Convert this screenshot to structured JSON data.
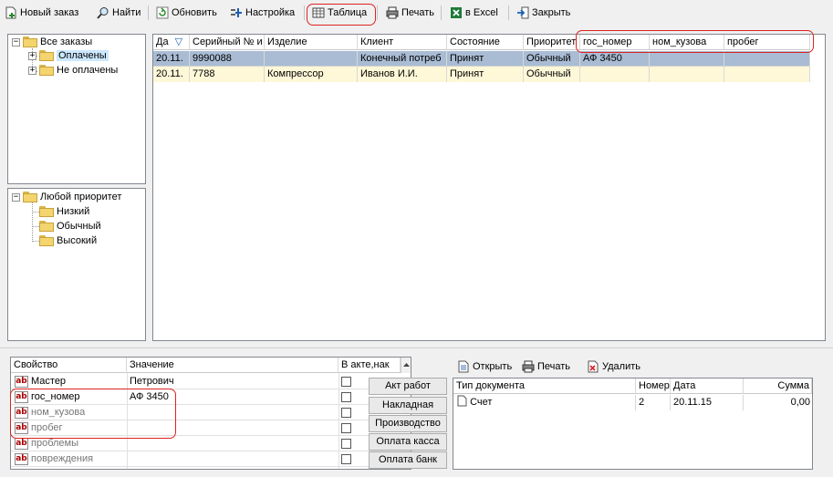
{
  "toolbar": {
    "new_order": "Новый заказ",
    "find": "Найти",
    "refresh": "Обновить",
    "settings": "Настройка",
    "table": "Таблица",
    "print": "Печать",
    "excel": "в Excel",
    "close": "Закрыть"
  },
  "tree_orders": {
    "root": "Все заказы",
    "paid": "Оплачены",
    "unpaid": "Не оплачены"
  },
  "tree_priority": {
    "root": "Любой приоритет",
    "low": "Низкий",
    "normal": "Обычный",
    "high": "Высокий"
  },
  "orders_grid": {
    "headers": [
      "Да",
      "Серийный № и",
      "Изделие",
      "Клиент",
      "Состояние",
      "Приоритет",
      "гос_номер",
      "ном_кузова",
      "пробег"
    ],
    "sort_indicator": "▽",
    "rows": [
      [
        "20.11.",
        "9990088",
        "",
        "Конечный потреб",
        "Принят",
        "Обычный",
        "АФ 3450",
        "",
        ""
      ],
      [
        "20.11.",
        "7788",
        "Компрессор",
        "Иванов И.И.",
        "Принят",
        "Обычный",
        "",
        "",
        ""
      ]
    ]
  },
  "properties": {
    "headers": [
      "Свойство",
      "Значение",
      "В акте,нак"
    ],
    "rows": [
      {
        "name": "Мастер",
        "value": "Петрович"
      },
      {
        "name": "гос_номер",
        "value": "АФ 3450"
      },
      {
        "name": "ном_кузова",
        "value": ""
      },
      {
        "name": "пробег",
        "value": ""
      },
      {
        "name": "проблемы",
        "value": ""
      },
      {
        "name": "повреждения",
        "value": ""
      }
    ]
  },
  "side_buttons": {
    "act": "Акт работ",
    "invoice": "Накладная",
    "production": "Производство",
    "cash": "Оплата касса",
    "bank": "Оплата банк"
  },
  "doc_toolbar": {
    "open": "Открыть",
    "print": "Печать",
    "delete": "Удалить"
  },
  "docs_grid": {
    "headers": [
      "Тип документа",
      "Номер",
      "Дата",
      "Сумма"
    ],
    "rows": [
      [
        "Счет",
        "2",
        "20.11.15",
        "0,00"
      ]
    ]
  }
}
